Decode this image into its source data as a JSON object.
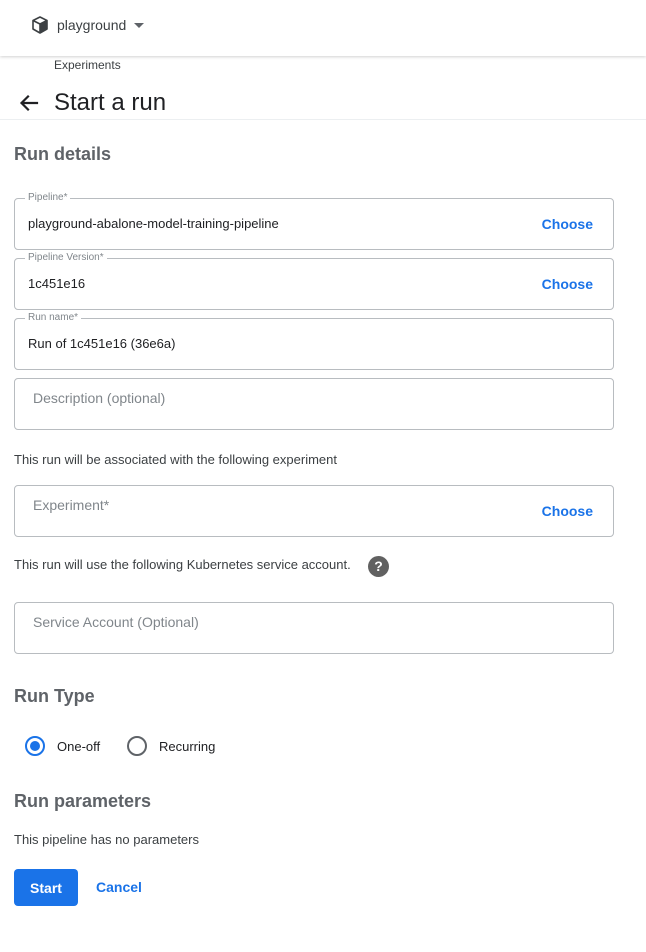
{
  "topbar": {
    "namespace": "playground",
    "namespace_icon": "cube-icon",
    "dropdown_icon": "caret-down-icon"
  },
  "header": {
    "breadcrumb": "Experiments",
    "back_icon": "arrow-back-icon",
    "title": "Start a run"
  },
  "run_details": {
    "heading": "Run details",
    "pipeline": {
      "label": "Pipeline*",
      "value": "playground-abalone-model-training-pipeline",
      "action": "Choose"
    },
    "pipeline_version": {
      "label": "Pipeline Version*",
      "value": "1c451e16",
      "action": "Choose"
    },
    "run_name": {
      "label": "Run name*",
      "value": "Run of 1c451e16 (36e6a)"
    },
    "description": {
      "placeholder": "Description (optional)"
    },
    "experiment_note": "This run will be associated with the following experiment",
    "experiment": {
      "placeholder": "Experiment*",
      "action": "Choose"
    },
    "service_account_note": "This run will use the following Kubernetes service account.",
    "help_icon": "?",
    "service_account": {
      "placeholder": "Service Account (Optional)"
    }
  },
  "run_type": {
    "heading": "Run Type",
    "options": [
      {
        "label": "One-off",
        "selected": true
      },
      {
        "label": "Recurring",
        "selected": false
      }
    ]
  },
  "run_parameters": {
    "heading": "Run parameters",
    "note": "This pipeline has no parameters"
  },
  "actions": {
    "start": "Start",
    "cancel": "Cancel"
  },
  "colors": {
    "accent": "#1a73e8",
    "heading": "#5f6368",
    "border": "#b8bcc0"
  }
}
